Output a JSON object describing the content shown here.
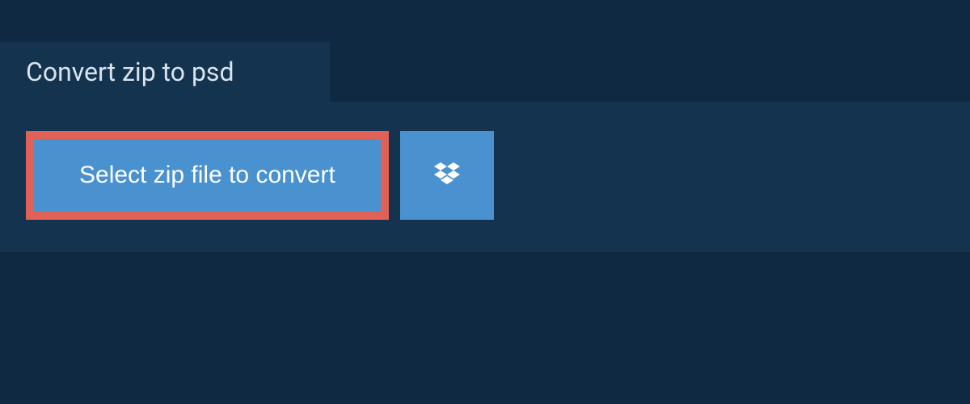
{
  "tab": {
    "title": "Convert zip to psd"
  },
  "actions": {
    "select_file_label": "Select zip file to convert"
  }
}
